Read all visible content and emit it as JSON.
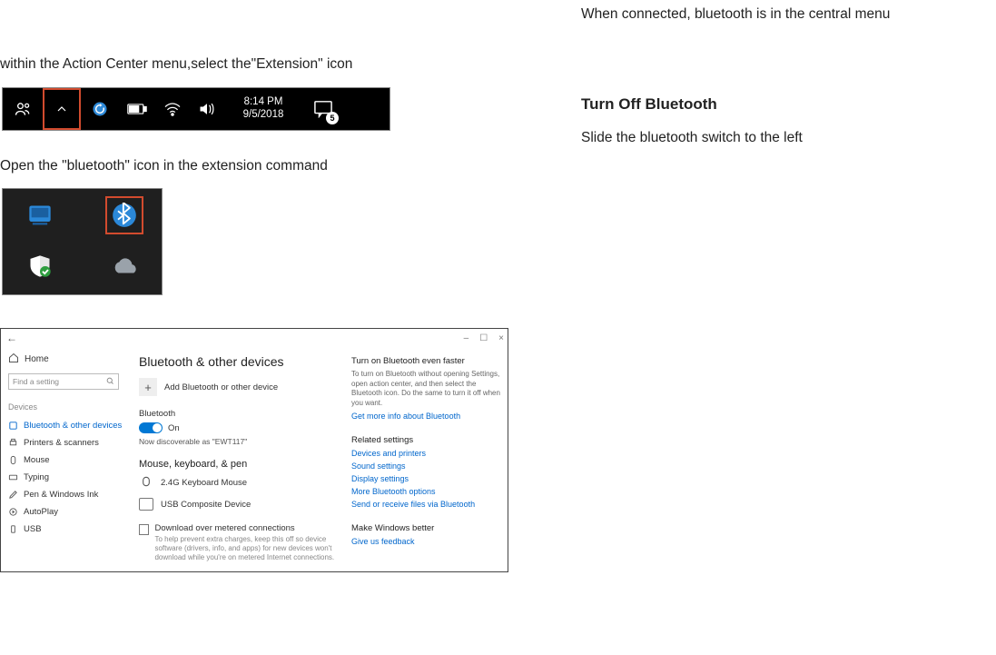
{
  "left": {
    "intro1": "within the Action Center menu,select the\"Extension\" icon",
    "intro2": "Open the \"bluetooth\" icon in the extension command"
  },
  "right": {
    "connected": "When connected, bluetooth is in the central menu",
    "heading": "Turn Off Bluetooth",
    "slide": "Slide the bluetooth switch to the left"
  },
  "taskbar": {
    "time": "8:14 PM",
    "date": "9/5/2018",
    "notifications_count": "5"
  },
  "settings": {
    "back_glyph": "←",
    "win_min": "–",
    "win_max": "☐",
    "win_close": "×",
    "home": "Home",
    "search_placeholder": "Find a setting",
    "devices_label": "Devices",
    "nav": {
      "bluetooth": "Bluetooth & other devices",
      "printers": "Printers & scanners",
      "mouse": "Mouse",
      "typing": "Typing",
      "pen": "Pen & Windows Ink",
      "autoplay": "AutoPlay",
      "usb": "USB"
    },
    "title": "Bluetooth & other devices",
    "add_device": "Add Bluetooth or other device",
    "bluetooth_label": "Bluetooth",
    "on_label": "On",
    "discoverable": "Now discoverable as \"EWT117\"",
    "mk_heading": "Mouse, keyboard, & pen",
    "dev1": "2.4G Keyboard Mouse",
    "dev2": "USB Composite Device",
    "metered_label": "Download over metered connections",
    "metered_desc": "To help prevent extra charges, keep this off so device software (drivers, info, and apps) for new devices won't download while you're on metered Internet connections.",
    "right_faster_h": "Turn on Bluetooth even faster",
    "right_faster_p": "To turn on Bluetooth without opening Settings, open action center, and then select the Bluetooth icon. Do the same to turn it off when you want.",
    "right_more_info": "Get more info about Bluetooth",
    "right_related_h": "Related settings",
    "right_link1": "Devices and printers",
    "right_link2": "Sound settings",
    "right_link3": "Display settings",
    "right_link4": "More Bluetooth options",
    "right_link5": "Send or receive files via Bluetooth",
    "right_better_h": "Make Windows better",
    "right_feedback": "Give us feedback"
  }
}
